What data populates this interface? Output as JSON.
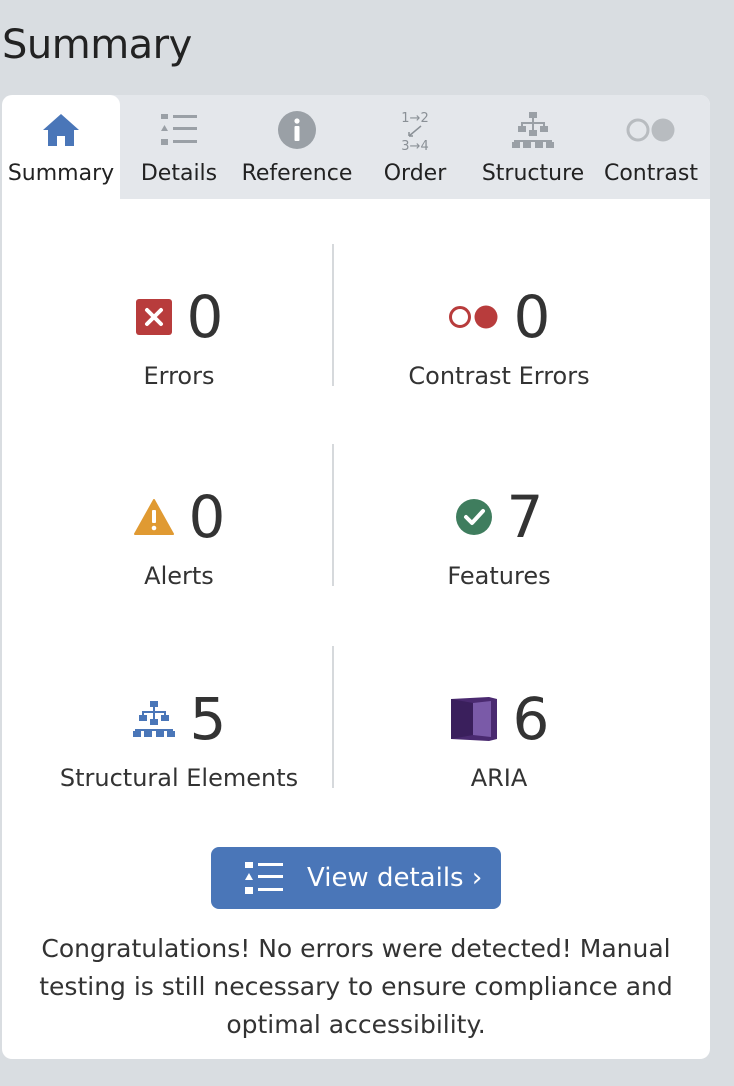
{
  "page": {
    "heading": "Summary"
  },
  "tabs": [
    {
      "label": "Summary",
      "icon": "home-icon",
      "active": true
    },
    {
      "label": "Details",
      "icon": "list-icon"
    },
    {
      "label": "Reference",
      "icon": "info-icon"
    },
    {
      "label": "Order",
      "icon": "order-icon",
      "icon_text": [
        "1→2",
        "3→4"
      ]
    },
    {
      "label": "Structure",
      "icon": "structure-icon"
    },
    {
      "label": "Contrast",
      "icon": "contrast-icon"
    }
  ],
  "stats": {
    "errors": {
      "value": "0",
      "label": "Errors",
      "icon": "error-icon",
      "color": "#b83c3c"
    },
    "contrast_errors": {
      "value": "0",
      "label": "Contrast Errors",
      "icon": "contrast-error-icon",
      "color": "#b83c3c"
    },
    "alerts": {
      "value": "0",
      "label": "Alerts",
      "icon": "alert-icon",
      "color": "#e09a32"
    },
    "features": {
      "value": "7",
      "label": "Features",
      "icon": "feature-icon",
      "color": "#3f7d5e"
    },
    "structural": {
      "value": "5",
      "label": "Structural Elements",
      "icon": "structure-icon",
      "color": "#4a76b8"
    },
    "aria": {
      "value": "6",
      "label": "ARIA",
      "icon": "aria-icon",
      "color": "#4a2a70"
    }
  },
  "actions": {
    "view_details": "View details ›"
  },
  "message": "Congratulations! No errors were detected! Manual testing is still necessary to ensure compliance and optimal accessibility.",
  "colors": {
    "accent": "#4a76b8",
    "tabbar": "#e4e7eb",
    "background": "#d9dde1"
  }
}
